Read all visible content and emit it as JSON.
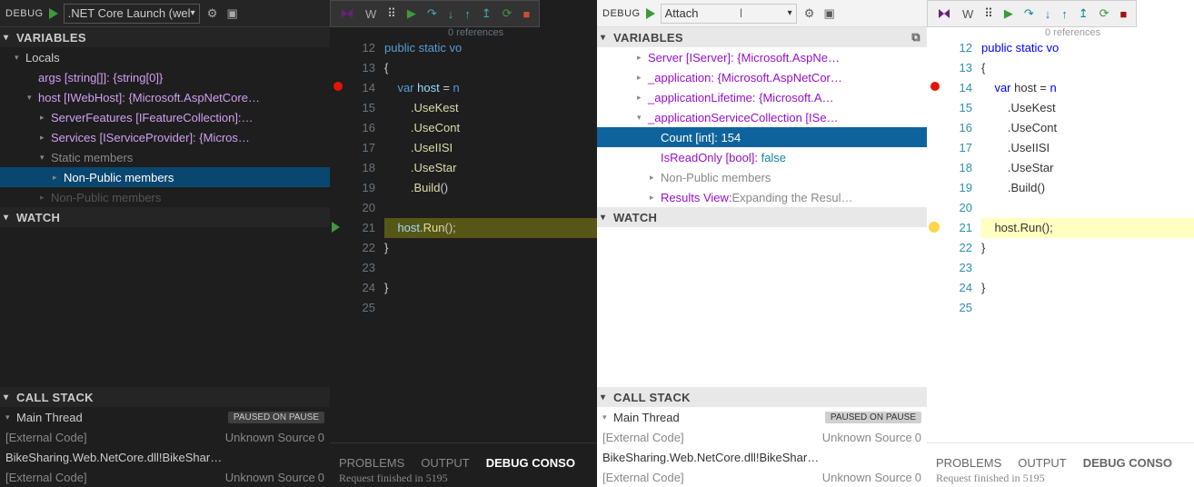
{
  "left": {
    "debugLabel": "DEBUG",
    "config": ".NET Core Launch (wel",
    "sections": {
      "variables": "VARIABLES",
      "watch": "WATCH",
      "callstack": "CALL STACK"
    },
    "locals": "Locals",
    "vars": {
      "args": "args [string[]]: {string[0]}",
      "host": "host [IWebHost]: {Microsoft.AspNetCore…",
      "sf": "ServerFeatures [IFeatureCollection]:…",
      "svc": "Services [IServiceProvider]: {Micros…",
      "sm": "Static members",
      "npm1": "Non-Public members",
      "npm2": "Non-Public members"
    },
    "cs": {
      "thread": "Main Thread",
      "paused": "PAUSED ON PAUSE",
      "r1": "[External Code]",
      "r1s": "Unknown Source",
      "r1n": "0",
      "r2": "BikeSharing.Web.NetCore.dll!BikeShar…",
      "r3": "[External Code]",
      "r3s": "Unknown Source",
      "r3n": "0"
    },
    "tabs": {
      "problems": "PROBLEMS",
      "output": "OUTPUT",
      "debug": "DEBUG CONSO"
    },
    "console": "Request finished in 5195"
  },
  "right": {
    "debugLabel": "DEBUG",
    "config": "Attach",
    "sections": {
      "variables": "VARIABLES",
      "watch": "WATCH",
      "callstack": "CALL STACK"
    },
    "vars": {
      "server": "Server [IServer]: {Microsoft.AspNe…",
      "app": "_application: {Microsoft.AspNetCor…",
      "appLife": "_applicationLifetime: {Microsoft.A…",
      "appSvc": "_applicationServiceCollection [ISe…",
      "count": "Count [int]:",
      "countVal": "154",
      "iro": "IsReadOnly [bool]:",
      "iroVal": "false",
      "npm": "Non-Public members",
      "rv": "Results View:",
      "rvTxt": " Expanding the Resul…"
    },
    "cs": {
      "thread": "Main Thread",
      "paused": "PAUSED ON PAUSE",
      "r1": "[External Code]",
      "r1s": "Unknown Source",
      "r1n": "0",
      "r2": "BikeSharing.Web.NetCore.dll!BikeShar…",
      "r3": "[External Code]",
      "r3s": "Unknown Source",
      "r3n": "0"
    },
    "tabs": {
      "problems": "PROBLEMS",
      "output": "OUTPUT",
      "debug": "DEBUG CONSO"
    },
    "console": "Request finished in 5195"
  },
  "code": {
    "refs": "0 references",
    "l11": "public static vo",
    "l12": "{",
    "l13": "    var host = n",
    "l14": "        .UseKest",
    "l15": "        .UseCont",
    "l16": "        .UseIISI",
    "l17": "        .UseStar",
    "l18": "        .Build()",
    "l21": "    host.Run();",
    "l22": "}",
    "l24": "}",
    "nums": [
      "12",
      "13",
      "14",
      "15",
      "16",
      "17",
      "18",
      "19",
      "20",
      "21",
      "22",
      "23",
      "24",
      "25"
    ]
  },
  "icons": {
    "gear": "⚙",
    "console": "▣",
    "grip": "⠿",
    "play": "▶",
    "step": "↷",
    "down": "↓",
    "up": "↑",
    "out": "↥",
    "restart": "⟳",
    "stop": "■",
    "tw": "▸",
    "twd": "▾"
  }
}
